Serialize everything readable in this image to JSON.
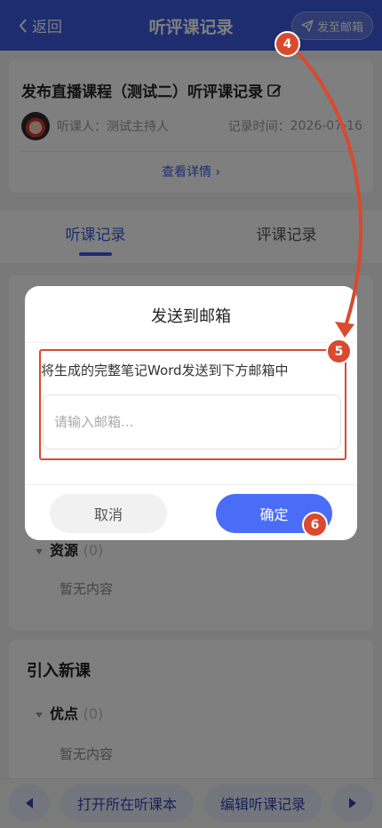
{
  "navbar": {
    "back_label": "返回",
    "title": "听评课记录",
    "send_label": "发至邮箱"
  },
  "info": {
    "course_title": "发布直播课程（测试二）听评课记录",
    "listener_label": "听课人：",
    "listener_name": "测试主持人",
    "record_time_label": "记录时间：",
    "record_time": "2026-07-16",
    "view_details": "查看详情 ›"
  },
  "tabs": [
    {
      "label": "听课记录",
      "active": true
    },
    {
      "label": "评课记录",
      "active": false
    }
  ],
  "resources": {
    "label": "资源",
    "count": "(0)",
    "empty": "暂无内容"
  },
  "new_course": {
    "title": "引入新课",
    "sub_label": "优点",
    "count": "(0)",
    "empty": "暂无内容"
  },
  "bottom_bar": {
    "open_notebook": "打开所在听课本",
    "edit_record": "编辑听课记录"
  },
  "dialog": {
    "title": "发送到邮箱",
    "description": "将生成的完整笔记Word发送到下方邮箱中",
    "email_placeholder": "请输入邮箱...",
    "email_value": "",
    "cancel_label": "取消",
    "confirm_label": "确定"
  },
  "annotations": {
    "badge_4": "4",
    "badge_5": "5",
    "badge_6": "6"
  },
  "colors": {
    "primary": "#3a5bde",
    "confirm": "#4a6cf7",
    "annotation": "#d94a2f"
  }
}
